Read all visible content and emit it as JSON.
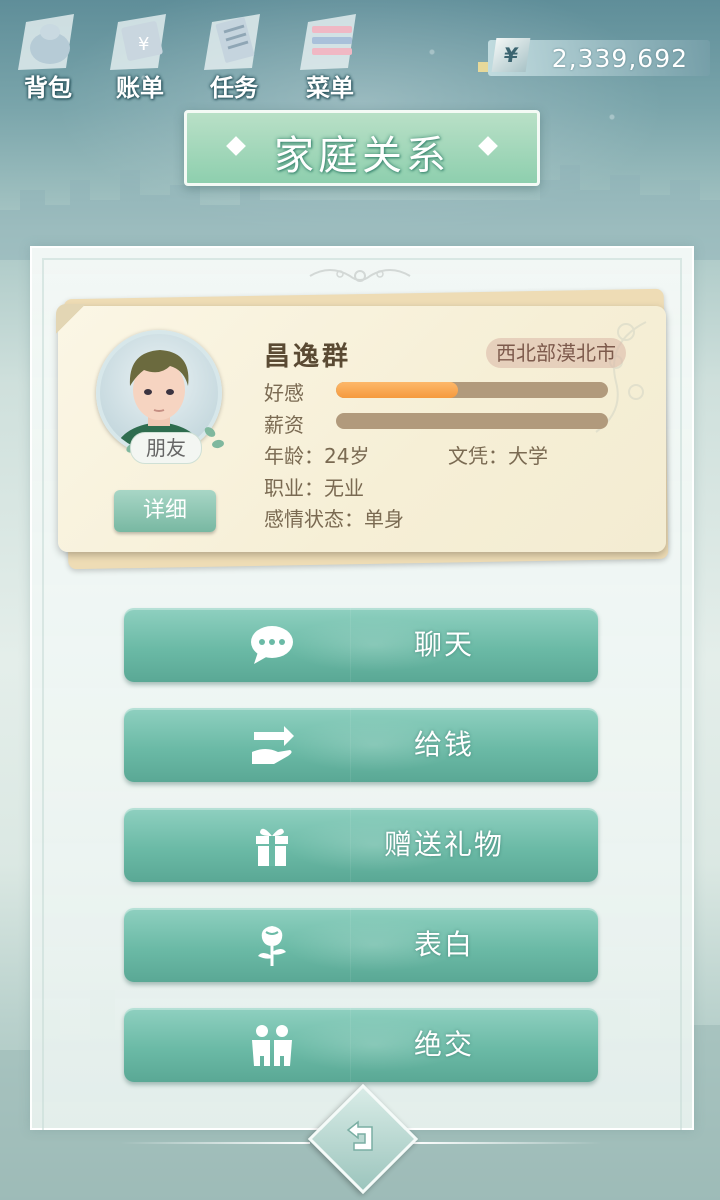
{
  "nav": [
    {
      "label": "背包",
      "icon": "backpack-icon"
    },
    {
      "label": "账单",
      "icon": "bill-icon"
    },
    {
      "label": "任务",
      "icon": "task-icon"
    },
    {
      "label": "菜单",
      "icon": "menu-icon"
    }
  ],
  "money": {
    "currency_symbol": "¥",
    "amount": "2,339,692"
  },
  "title": "家庭关系",
  "profile": {
    "name": "昌逸群",
    "location": "西北部漠北市",
    "relation": "朋友",
    "detail_button": "详细",
    "favor_label": "好感",
    "favor_level": 0.45,
    "salary_label": "薪资",
    "salary_level": 0.0,
    "age": "年龄：24岁",
    "education": "文凭：大学",
    "occupation": "职业：无业",
    "relationship_status": "感情状态：单身"
  },
  "actions": [
    {
      "label": "聊天",
      "icon": "chat-icon"
    },
    {
      "label": "给钱",
      "icon": "give-money-icon"
    },
    {
      "label": "赠送礼物",
      "icon": "gift-icon"
    },
    {
      "label": "表白",
      "icon": "rose-icon"
    },
    {
      "label": "绝交",
      "icon": "people-icon"
    }
  ],
  "colors": {
    "accent": "#6bbaa6",
    "favor_bar": "#f59a3e",
    "title_bg": "#8ecfae",
    "card_bg": "#f6efd6"
  }
}
